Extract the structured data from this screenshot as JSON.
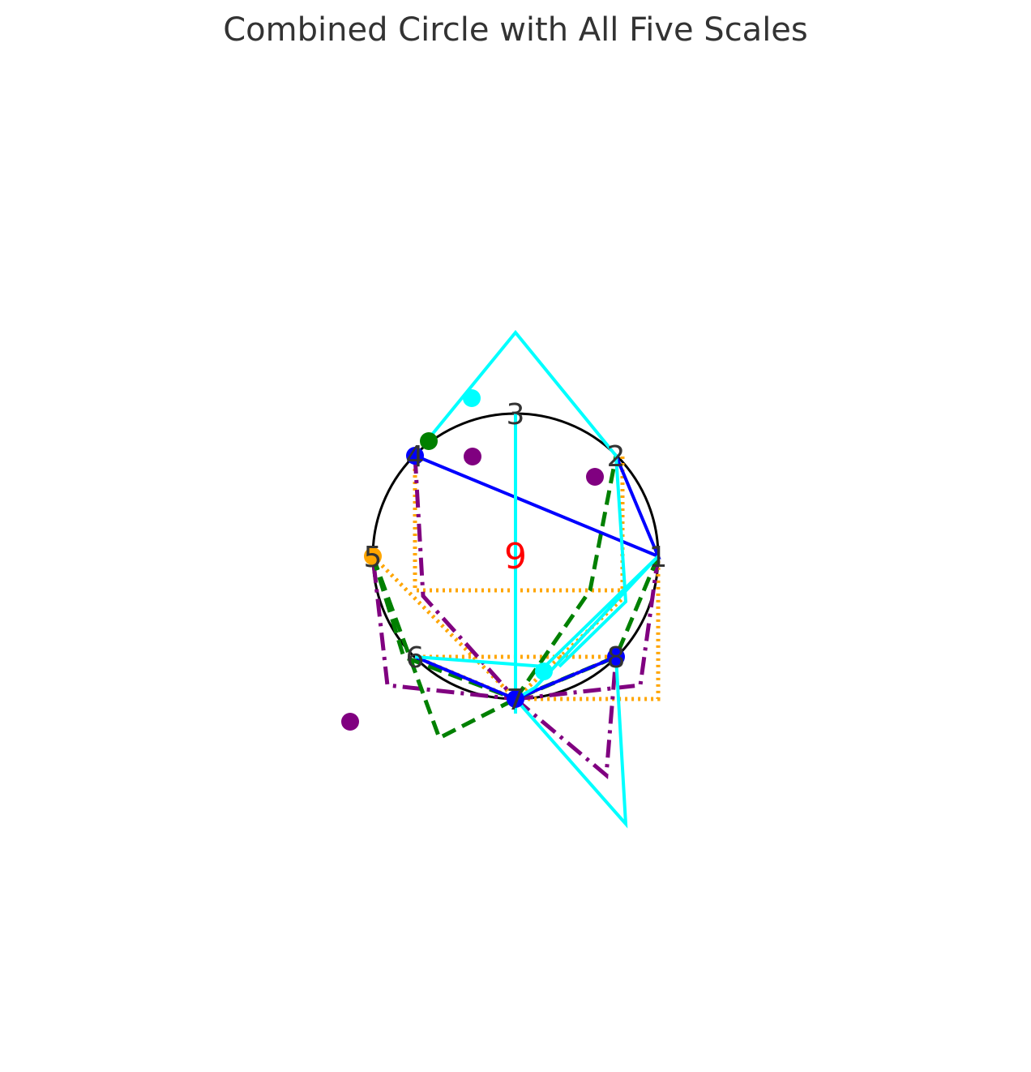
{
  "title": "Combined Circle with All Five Scales",
  "center_label": "9",
  "colors": {
    "circle": "#000000",
    "center_label": "#ff0000",
    "scale_1": "#0000ff",
    "scale_2": "#008000",
    "scale_3": "#ffa500",
    "scale_4": "#800080",
    "scale_5": "#00ffff"
  },
  "nodes": [
    {
      "label": "1"
    },
    {
      "label": "2"
    },
    {
      "label": "3"
    },
    {
      "label": "4"
    },
    {
      "label": "5"
    },
    {
      "label": "6"
    },
    {
      "label": "7"
    },
    {
      "label": "8"
    }
  ],
  "scales": [
    {
      "color": "#0000ff",
      "line_style": "solid"
    },
    {
      "color": "#008000",
      "line_style": "dashed"
    },
    {
      "color": "#ffa500",
      "line_style": "dotted"
    },
    {
      "color": "#800080",
      "line_style": "dash-dot"
    },
    {
      "color": "#00ffff",
      "line_style": "solid"
    }
  ]
}
